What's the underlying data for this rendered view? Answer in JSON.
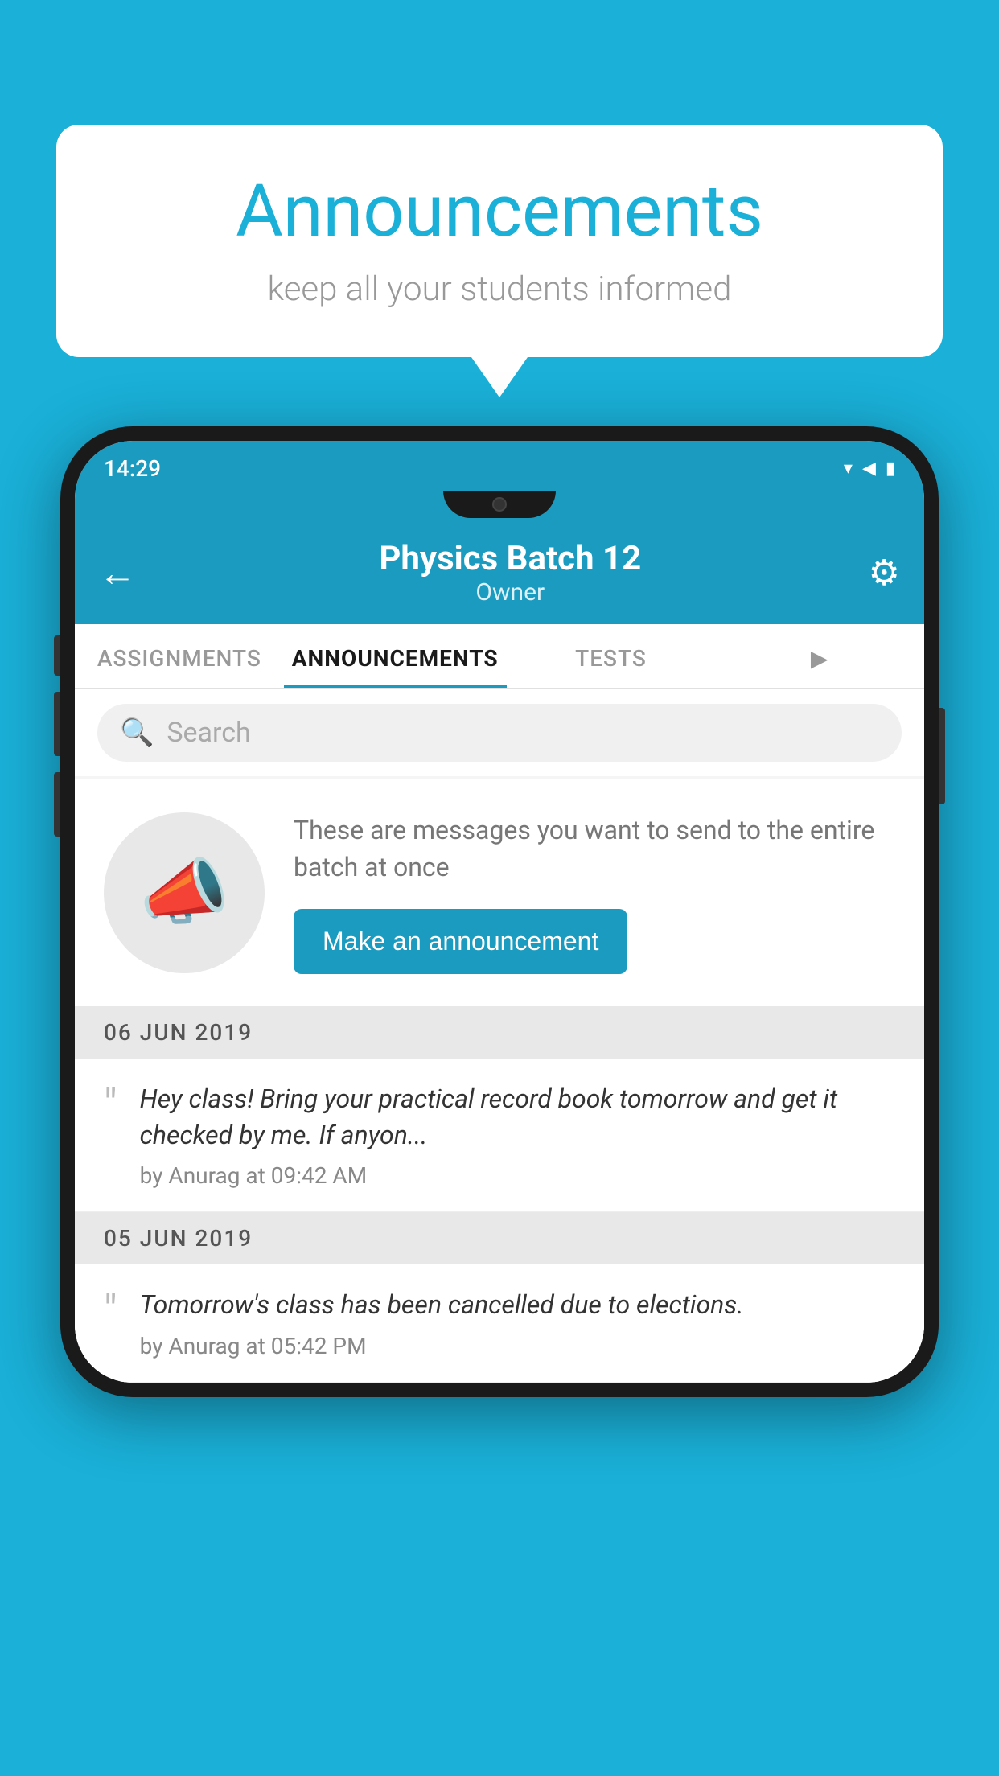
{
  "background_color": "#1ab0d8",
  "speech_bubble": {
    "title": "Announcements",
    "subtitle": "keep all your students informed"
  },
  "phone": {
    "status_bar": {
      "time": "14:29",
      "wifi": "▾",
      "signal": "▲",
      "battery": "▮"
    },
    "header": {
      "title": "Physics Batch 12",
      "subtitle": "Owner",
      "back_label": "←",
      "settings_label": "⚙"
    },
    "tabs": [
      {
        "label": "ASSIGNMENTS",
        "active": false
      },
      {
        "label": "ANNOUNCEMENTS",
        "active": true
      },
      {
        "label": "TESTS",
        "active": false
      },
      {
        "label": "▶",
        "active": false
      }
    ],
    "search": {
      "placeholder": "Search"
    },
    "announcement_prompt": {
      "description": "These are messages you want to send to the entire batch at once",
      "button_label": "Make an announcement"
    },
    "announcements": [
      {
        "date": "06  JUN  2019",
        "items": [
          {
            "text": "Hey class! Bring your practical record book tomorrow and get it checked by me. If anyon...",
            "meta": "by Anurag at 09:42 AM"
          }
        ]
      },
      {
        "date": "05  JUN  2019",
        "items": [
          {
            "text": "Tomorrow's class has been cancelled due to elections.",
            "meta": "by Anurag at 05:42 PM"
          }
        ]
      }
    ]
  }
}
